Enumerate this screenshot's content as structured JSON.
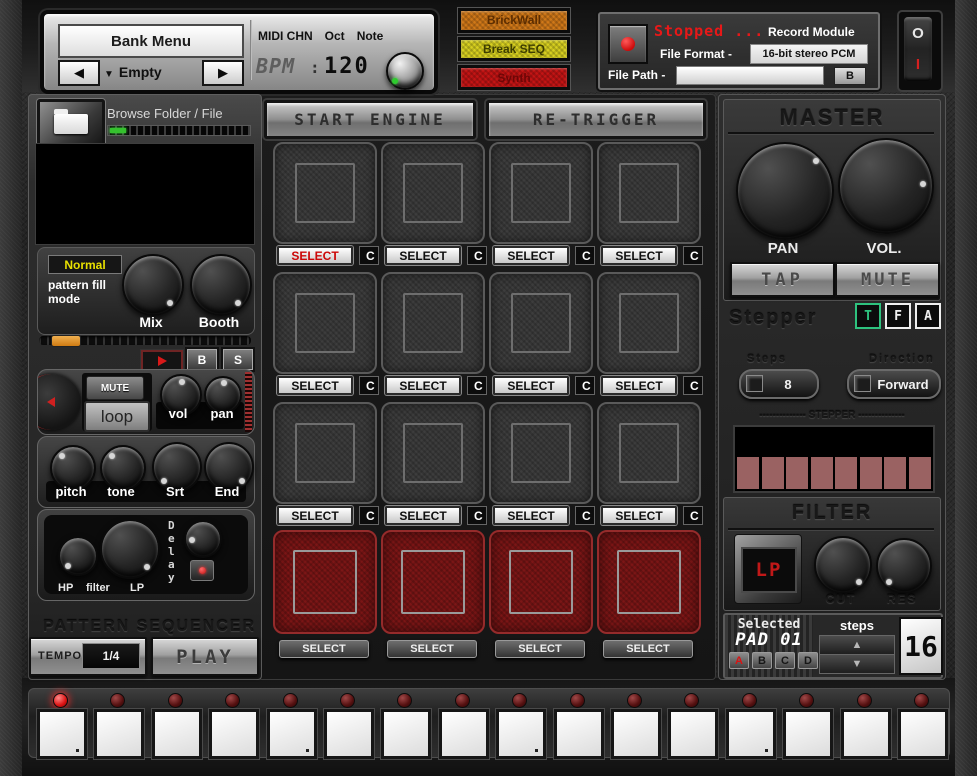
{
  "colors": {
    "brickwall": "#d07818",
    "break_seq": "#d8d020",
    "synth": "#c41414",
    "status_stopped": "#e81818",
    "fill_mode_value": "#e8e000",
    "step_cell": "#9a6262",
    "led_lit": "#dc1212",
    "lp_text": "#c01818",
    "tfa_active": "#2ec27e",
    "select_active_text": "#cc0808"
  },
  "header": {
    "bank": {
      "title": "Bank Menu",
      "prev_icon": "◀",
      "next_icon": "▶",
      "dropdown_icon": "▼",
      "dropdown_value": "Empty",
      "midi_chn_label": "MIDI CHN",
      "oct_label": "Oct",
      "note_label": "Note",
      "bpm_label": "BPM",
      "bpm_separator": ":",
      "bpm_value": "120"
    },
    "fx_buttons": [
      {
        "label": "BrickWall"
      },
      {
        "label": "Break SEQ"
      },
      {
        "label": "Synth"
      }
    ],
    "record": {
      "status": "Stopped ...",
      "module_title": "Record Module",
      "file_format_label": "File Format -",
      "file_format_value": "16-bit stereo PCM",
      "file_path_label": "File Path -",
      "file_path_value": "",
      "browse_button": "B"
    },
    "power": {
      "off_label": "O",
      "on_label": "I"
    }
  },
  "left_panel": {
    "browse_label": "Browse Folder / File",
    "fill_mode_value": "Normal",
    "fill_mode_label": "pattern fill mode",
    "mix_label": "Mix",
    "booth_label": "Booth",
    "b_button": "B",
    "s_button": "S",
    "mute_button": "MUTE",
    "loop_button": "loop",
    "vol_label": "vol",
    "pan_label": "pan",
    "knob_labels": [
      "pitch",
      "tone",
      "Srt",
      "End"
    ],
    "hp_label": "HP",
    "filter_label": "filter",
    "lp_label": "LP",
    "delay_label": "Delay",
    "sequencer_title": "PATTERN SEQUENCER",
    "tempo_label": "TEMPO",
    "tempo_value": "1/4",
    "play_label": "PLAY"
  },
  "engine": {
    "start_label": "START ENGINE",
    "retrigger_label": "RE-TRIGGER"
  },
  "pads": {
    "select_label": "SELECT",
    "clear_label": "C",
    "rows": 4,
    "cols": 4,
    "red_row_index": 3,
    "selected_row": 0,
    "selected_col": 0
  },
  "right_panel": {
    "master": {
      "title": "MASTER",
      "pan_label": "PAN",
      "vol_label": "VOL.",
      "tap_button": "TAP",
      "mute_button": "MUTE"
    },
    "stepper": {
      "title": "Stepper",
      "mode_buttons": [
        "T",
        "F",
        "A"
      ],
      "active_mode_index": 0,
      "steps_label": "Steps",
      "steps_value": "8",
      "direction_label": "Direction",
      "direction_value": "Forward",
      "grid_title": "-------------- STEPPER --------------",
      "cell_count": 8
    },
    "filter": {
      "title": "FILTER",
      "mode_value": "LP",
      "cut_label": "CUT",
      "res_label": "RES"
    },
    "selected_pad": {
      "label": "Selected",
      "value": "PAD 01",
      "bank_buttons": [
        "A",
        "B",
        "C",
        "D"
      ],
      "active_bank_index": 0,
      "steps_label": "steps",
      "steps_value": "16",
      "up_icon": "▲",
      "down_icon": "▼"
    }
  },
  "keyboard": {
    "key_count": 16,
    "lit_led_index": 0,
    "marker_key_indices": [
      0,
      4,
      8,
      12
    ]
  }
}
